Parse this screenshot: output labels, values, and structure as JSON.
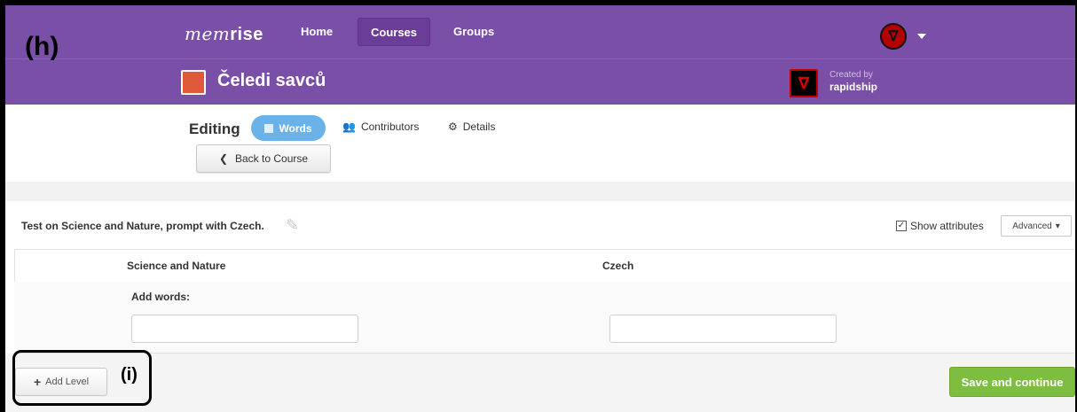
{
  "annotations": {
    "panel_h": "(h)",
    "panel_i": "(i)"
  },
  "nav": {
    "logo_italic": "mem",
    "logo_bold": "rise",
    "links": [
      "Home",
      "Courses",
      "Groups"
    ],
    "active": "Courses"
  },
  "course": {
    "title": "Čeledi savců",
    "created_by_label": "Created by",
    "creator": "rapidship"
  },
  "editing": {
    "label": "Editing",
    "tabs": [
      "Words",
      "Contributors",
      "Details"
    ],
    "back_button": "Back to Course"
  },
  "level": {
    "description": "Test on Science and Nature, prompt with Czech.",
    "show_attributes_label": "Show attributes",
    "show_attributes_checked": true,
    "advanced_label": "Advanced"
  },
  "table": {
    "columns": [
      "Science and Nature",
      "Czech"
    ],
    "add_words_label": "Add words:"
  },
  "footer": {
    "add_level": "Add Level",
    "save": "Save and continue"
  },
  "colors": {
    "brand": "#7a4fa8",
    "tab_active": "#6ab2e8",
    "save": "#7dbd3f"
  }
}
